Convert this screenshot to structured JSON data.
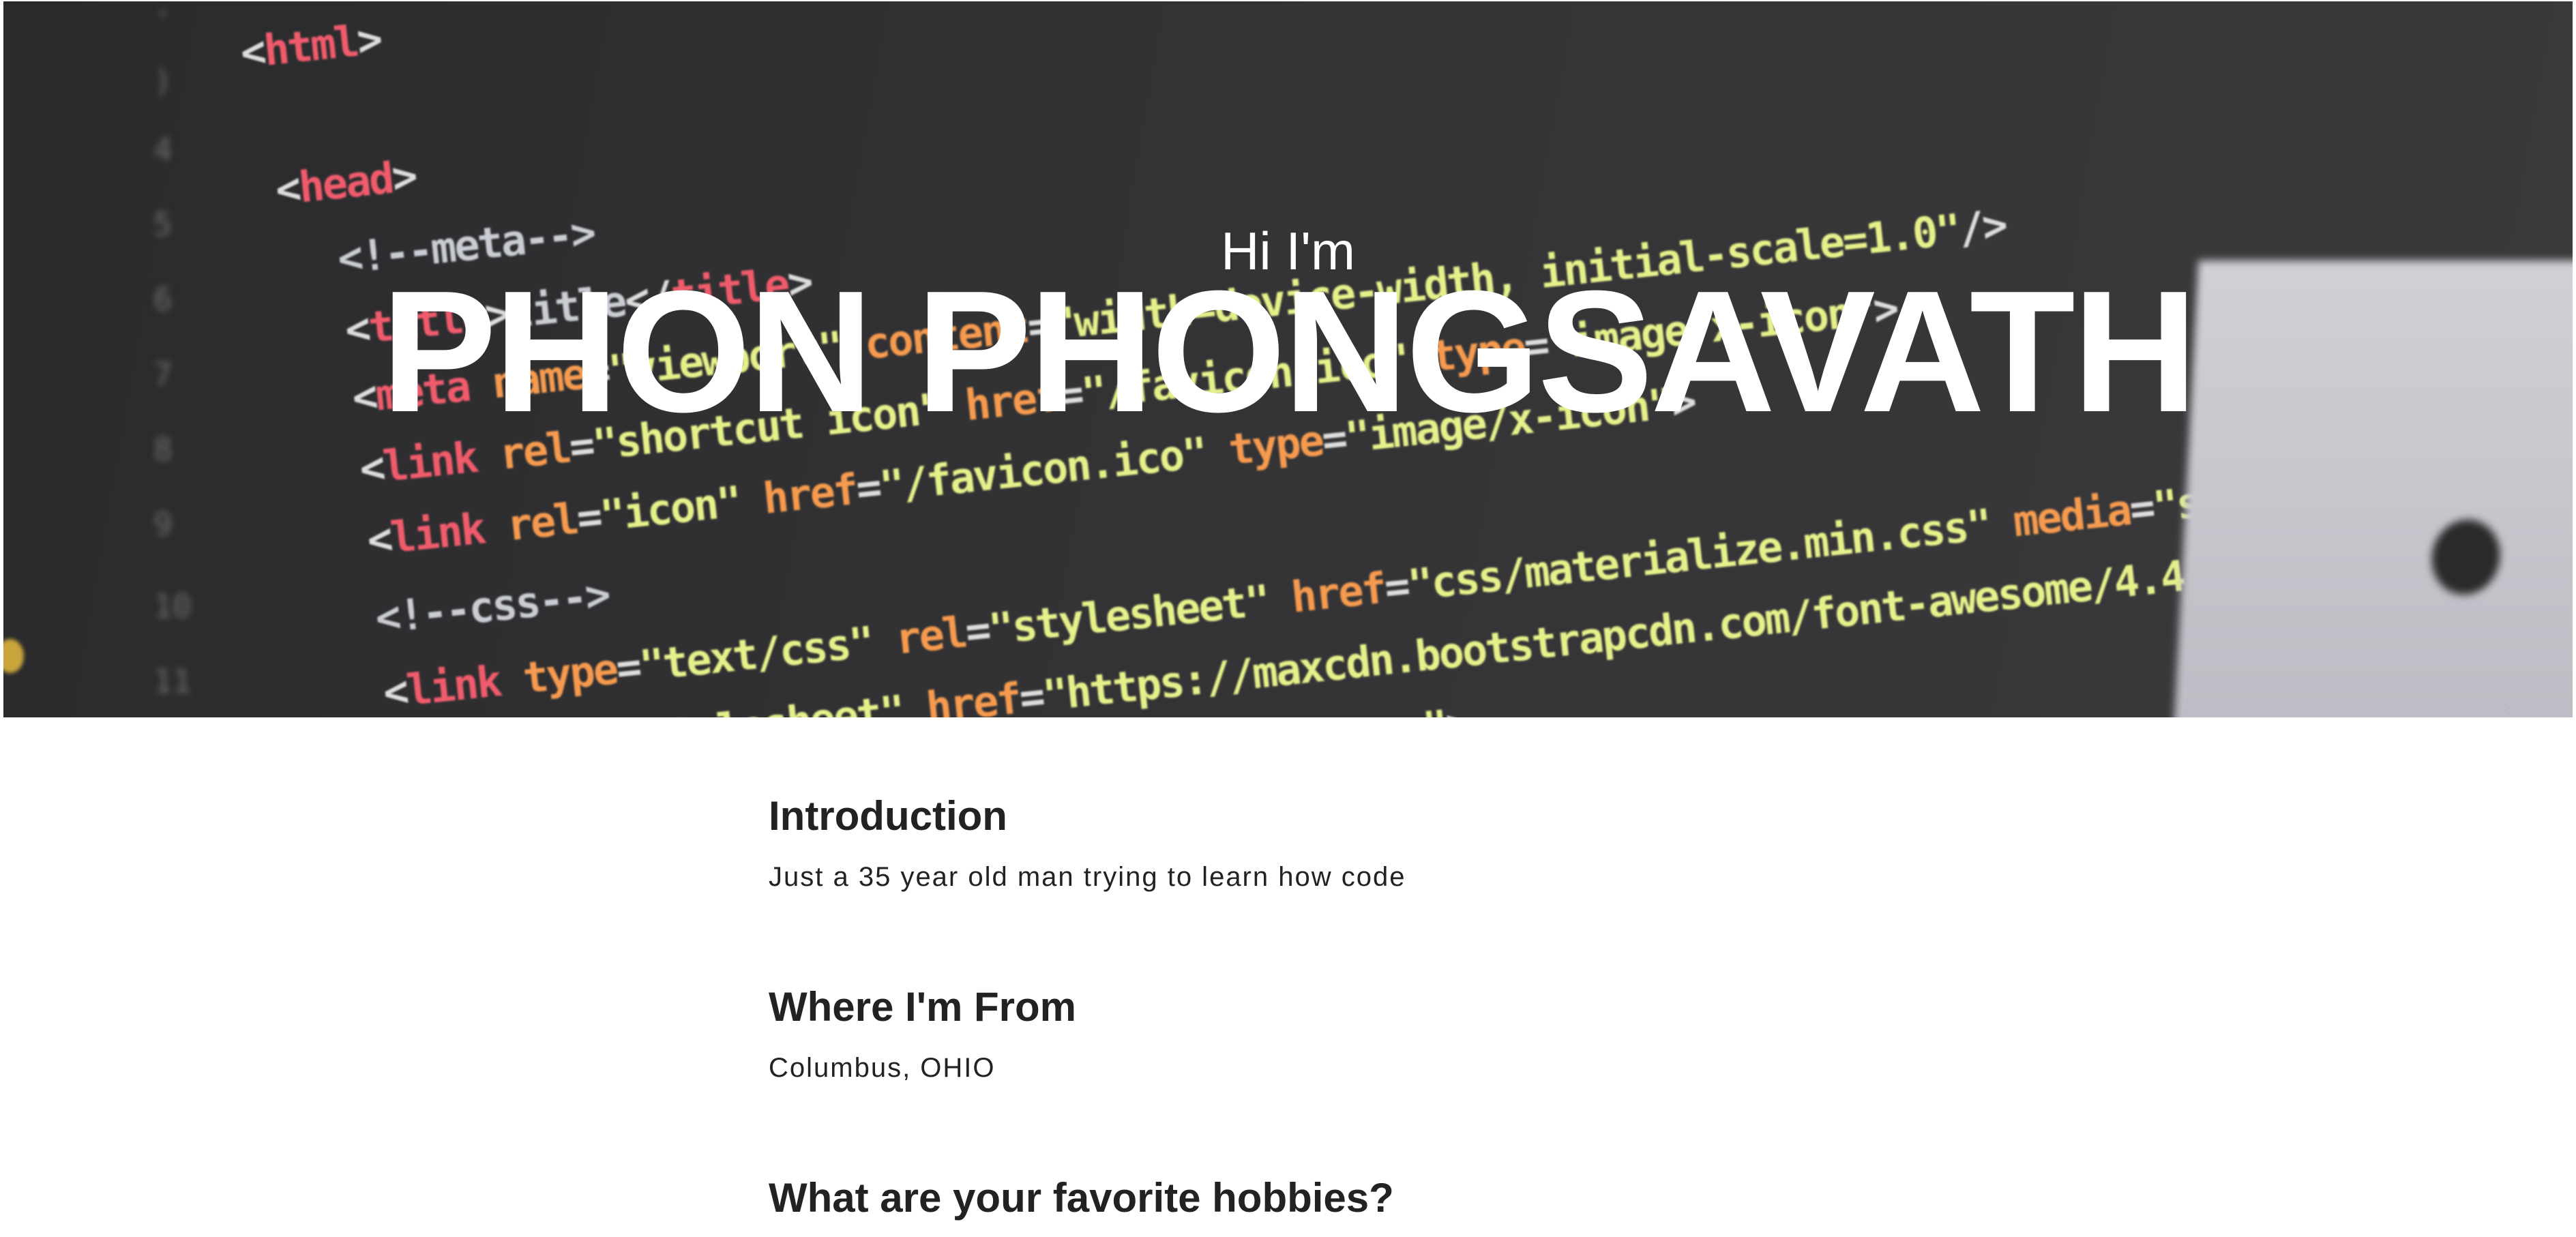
{
  "hero": {
    "greeting": "Hi I'm",
    "name": "PHON PHONGSAVATH"
  },
  "sections": [
    {
      "heading": "Introduction",
      "body": "Just a 35 year old man trying to learn how code"
    },
    {
      "heading": "Where I'm From",
      "body": "Columbus, OHIO"
    },
    {
      "heading": "What are your favorite hobbies?"
    }
  ],
  "colors": {
    "hero_background": "#333335",
    "text_primary": "#222222",
    "hero_text": "#ffffff"
  }
}
